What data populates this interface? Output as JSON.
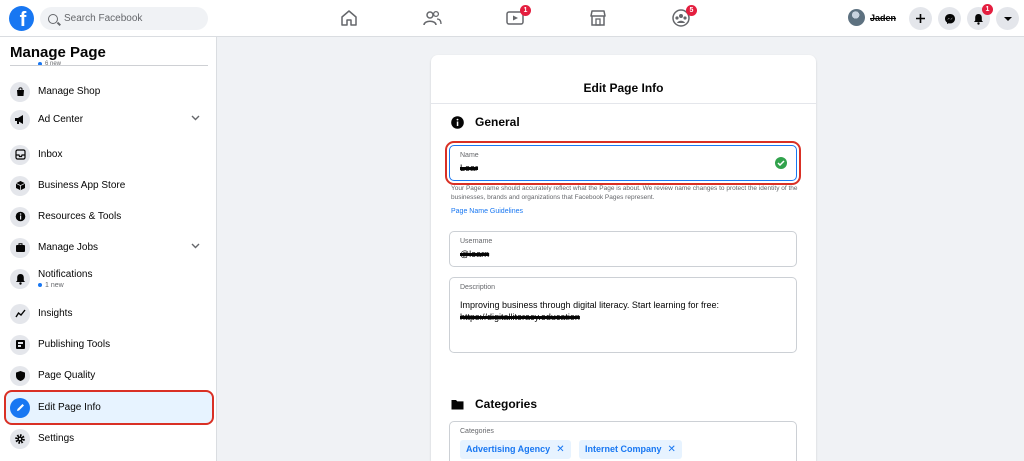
{
  "topbar": {
    "logo_letter": "f",
    "search_placeholder": "Search Facebook",
    "nav": [
      {
        "name": "home-icon",
        "badge": ""
      },
      {
        "name": "friends-icon",
        "badge": ""
      },
      {
        "name": "watch-icon",
        "badge": "1"
      },
      {
        "name": "marketplace-icon",
        "badge": ""
      },
      {
        "name": "groups-icon",
        "badge": "5"
      }
    ],
    "profile_name": "Jaden",
    "notifications_badge": "1"
  },
  "sidebar": {
    "title": "Manage Page",
    "partial_sub": "6 new",
    "items": [
      {
        "label": "Manage Shop",
        "icon": "shop-icon"
      },
      {
        "label": "Ad Center",
        "icon": "megaphone-icon"
      },
      {
        "label": "Inbox",
        "icon": "inbox-icon"
      },
      {
        "label": "Business App Store",
        "icon": "cube-icon"
      },
      {
        "label": "Resources & Tools",
        "icon": "info-icon"
      },
      {
        "label": "Manage Jobs",
        "icon": "briefcase-icon"
      },
      {
        "label": "Notifications",
        "icon": "bell-icon",
        "sub": "1 new"
      },
      {
        "label": "Insights",
        "icon": "insights-icon"
      },
      {
        "label": "Publishing Tools",
        "icon": "publishing-icon"
      },
      {
        "label": "Page Quality",
        "icon": "shield-icon"
      },
      {
        "label": "Edit Page Info",
        "icon": "pencil-icon"
      },
      {
        "label": "Settings",
        "icon": "gear-icon"
      }
    ]
  },
  "card": {
    "title": "Edit Page Info",
    "general": {
      "heading": "General",
      "name_label": "Name",
      "name_value": "Lear",
      "help_text": "Your Page name should accurately reflect what the Page is about. We review name changes to protect the identity of the businesses, brands and organizations that Facebook Pages represent.",
      "help_link": "Page Name Guidelines",
      "username_label": "Username",
      "username_value": "@learn",
      "description_label": "Description",
      "description_value": "Improving business through digital literacy. Start learning for free:",
      "description_link": "https://digitalliteracy.education"
    },
    "categories": {
      "heading": "Categories",
      "label": "Categories",
      "chips": [
        "Advertising Agency",
        "Internet Company"
      ]
    }
  },
  "colors": {
    "brand": "#1877f2",
    "highlight": "#d93025",
    "success": "#31a24c",
    "badge": "#e41e3f"
  }
}
